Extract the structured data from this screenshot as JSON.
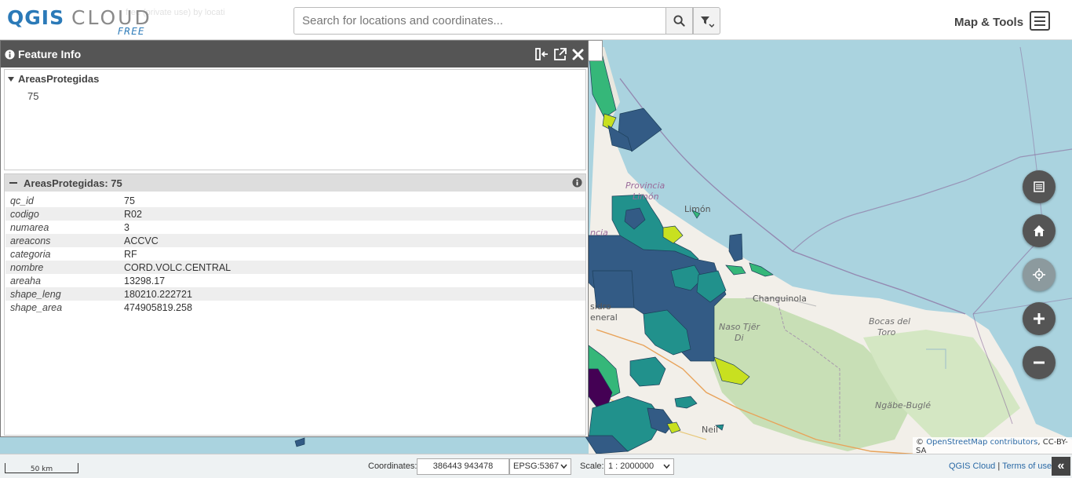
{
  "app": {
    "logo_main": "QGIS",
    "logo_cloud": "CLOUD",
    "logo_sub": "FREE",
    "ghost_text": "free (private use) by locati"
  },
  "search": {
    "placeholder": "Search for locations and coordinates..."
  },
  "header": {
    "map_tools_label": "Map & Tools"
  },
  "feature_info": {
    "title": "Feature Info",
    "tree": {
      "layer": "AreasProtegidas",
      "feature": "75"
    },
    "detail_title": "AreasProtegidas: 75",
    "attributes": [
      {
        "key": "qc_id",
        "value": "75"
      },
      {
        "key": "codigo",
        "value": "R02"
      },
      {
        "key": "numarea",
        "value": "3"
      },
      {
        "key": "areacons",
        "value": "ACCVC"
      },
      {
        "key": "categoria",
        "value": "RF"
      },
      {
        "key": "nombre",
        "value": "CORD.VOLC.CENTRAL"
      },
      {
        "key": "areaha",
        "value": "13298.17"
      },
      {
        "key": "shape_leng",
        "value": "180210.222721"
      },
      {
        "key": "shape_area",
        "value": "474905819.258"
      }
    ]
  },
  "map_labels": {
    "provincia": "Provincia",
    "limon_prov": "Limón",
    "limon": "Limón",
    "ncia": "ncia",
    "changuinola": "Changuinola",
    "naso": "Naso Tjër",
    "di": "Di",
    "bocas": "Bocas del",
    "toro": "Toro",
    "ngabe": "Ngäbe-Buglé",
    "isidro": "sidro",
    "general": "eneral",
    "neily": "Neil"
  },
  "attribution": {
    "prefix": "© ",
    "link": "OpenStreetMap contributors",
    "suffix": ", CC-BY-SA"
  },
  "bottombar": {
    "scalebar_label": "50 km",
    "coord_label": "Coordinates:",
    "coord_value": "386443 943478",
    "epsg": "EPSG:5367",
    "scale_label": "Scale:",
    "scale_value": "1 : 2000000",
    "link_cloud": "QGIS Cloud",
    "link_separator": "|",
    "link_terms": "Terms of use",
    "collapse_icon": "«"
  },
  "colors": {
    "panel_header": "#555555",
    "sea": "#a9d3df",
    "land": "#f1eee6",
    "protected_dark": "#335b85",
    "protected_teal": "#21918c",
    "protected_green": "#35b779",
    "protected_lime": "#c8e020",
    "link": "#2b6aa6"
  }
}
